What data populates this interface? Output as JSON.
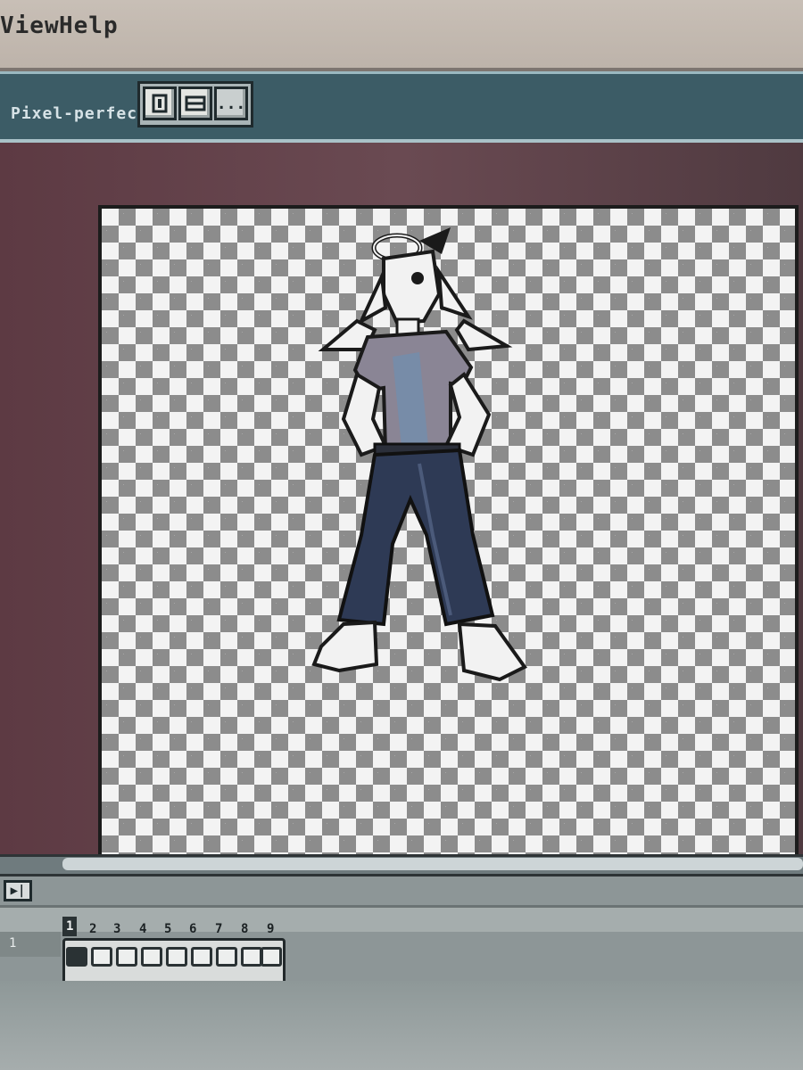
{
  "menubar": {
    "items": [
      {
        "label": "View"
      },
      {
        "label": "Help"
      }
    ]
  },
  "toolbar": {
    "label": "Pixel-perfect",
    "buttons": [
      {
        "icon": "pixel-grid-icon"
      },
      {
        "icon": "onion-skin-icon"
      },
      {
        "icon": "more-options-icon",
        "label": "..."
      }
    ]
  },
  "timeline": {
    "play_label": "▶|",
    "layer_name": "1",
    "frames": [
      "1",
      "2",
      "3",
      "4",
      "5",
      "6",
      "7",
      "8",
      "9"
    ],
    "active_frame": "1"
  },
  "colors": {
    "canvas_checker_dark": "#8c8c8c",
    "canvas_checker_light": "#f3f3f3",
    "workspace_bg": "#5d3a43",
    "toolbar_bg": "#3c5c66"
  }
}
